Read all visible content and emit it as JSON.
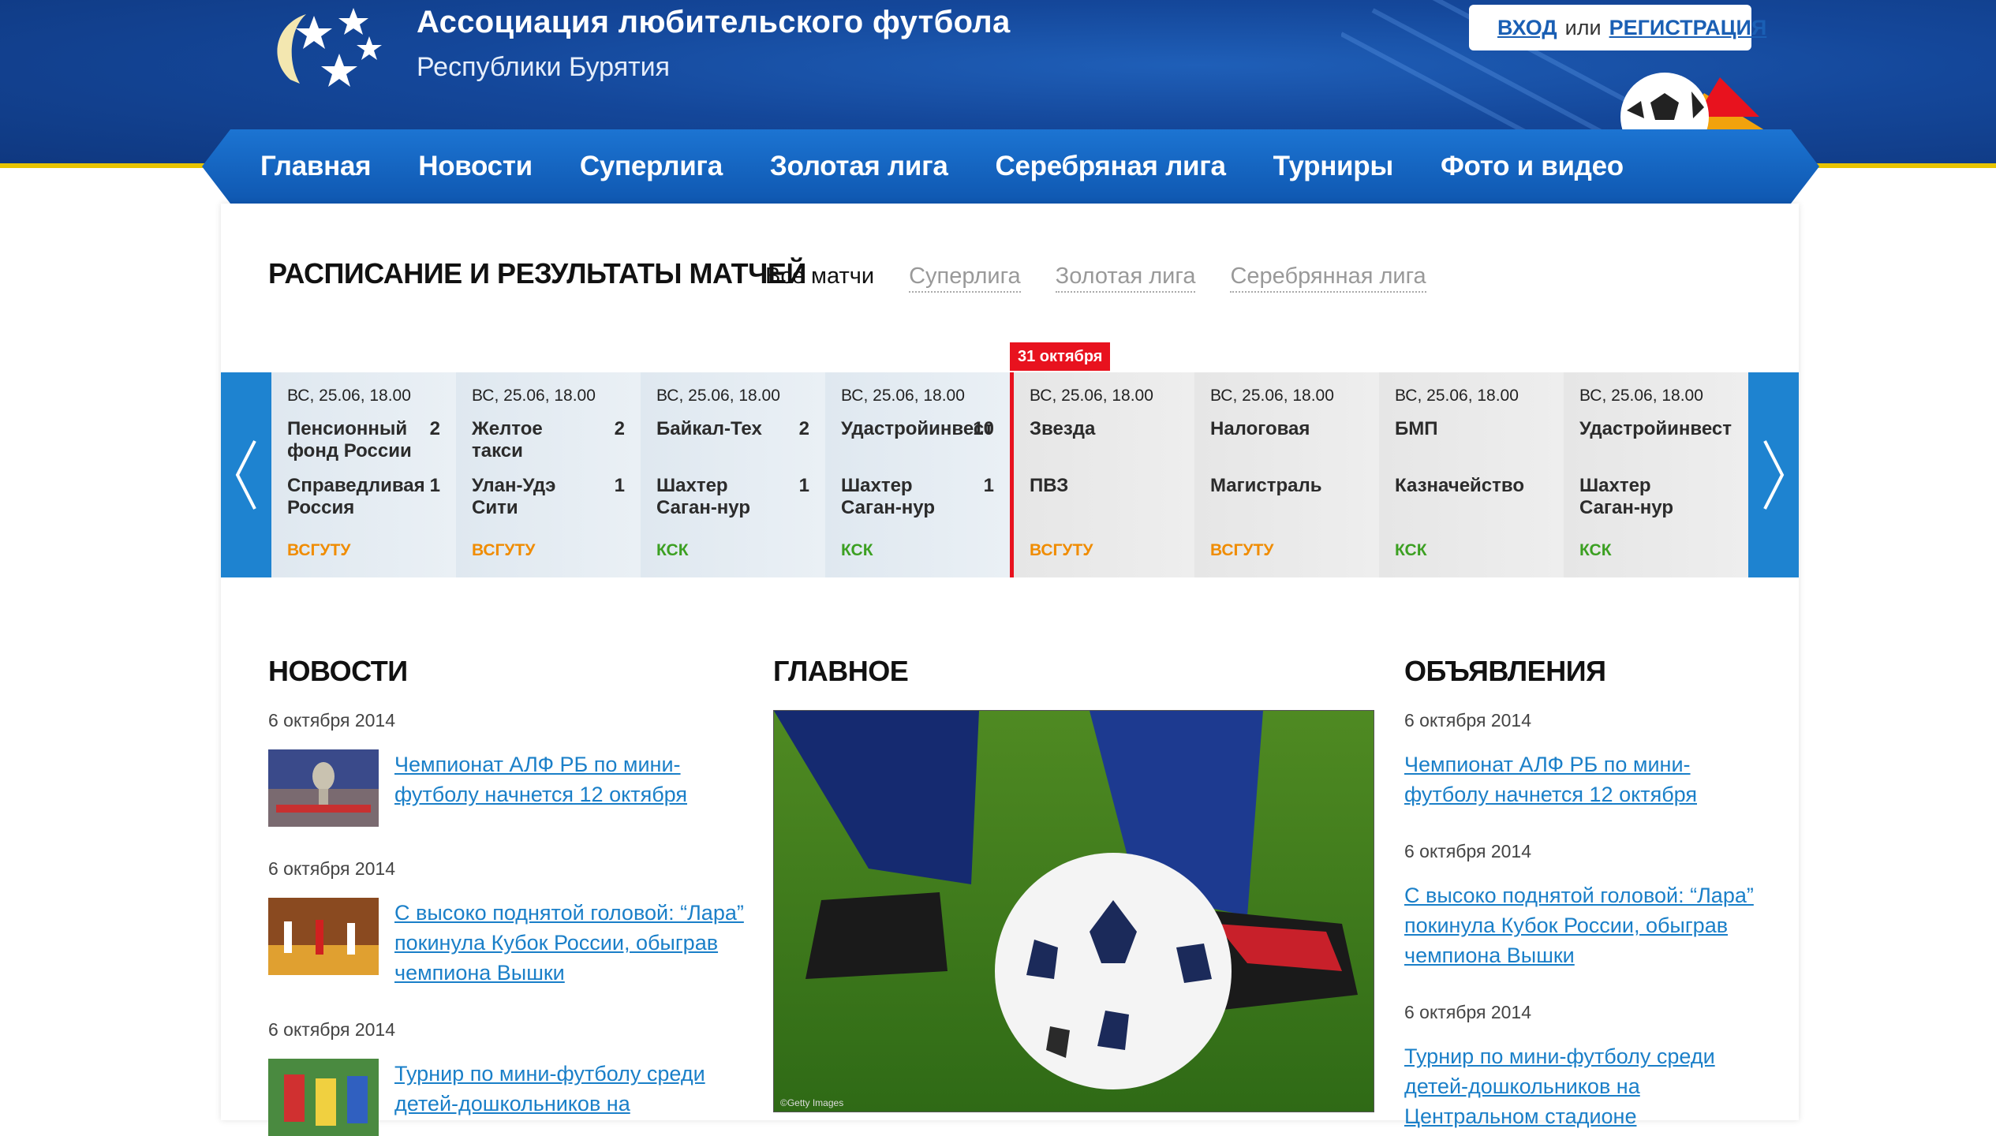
{
  "header": {
    "title": "Ассоциация любительского футбола",
    "subtitle": "Республики Бурятия",
    "login": {
      "enter": "ВХОД",
      "or": "или",
      "register": "РЕГИСТРАЦИЯ"
    }
  },
  "nav": [
    "Главная",
    "Новости",
    "Суперлига",
    "Золотая лига",
    "Серебряная лига",
    "Турниры",
    "Фото и видео"
  ],
  "schedule": {
    "title": "РАСПИСАНИЕ И РЕЗУЛЬТАТЫ МАТЧЕЙ",
    "filters": [
      "Все матчи",
      "Суперлига",
      "Золотая лига",
      "Серебрянная лига"
    ],
    "today_badge": "31 октября",
    "matches": [
      {
        "date": "ВС, 25.06, 18.00",
        "home": "Пенсионный фонд России",
        "home_score": "2",
        "away": "Справедливая Россия",
        "away_score": "1",
        "venue": "ВСГУТУ",
        "venue_color": "#f08c00"
      },
      {
        "date": "ВС, 25.06, 18.00",
        "home": "Желтое такси",
        "home_score": "2",
        "away": "Улан-Удэ Сити",
        "away_score": "1",
        "venue": "ВСГУТУ",
        "venue_color": "#f08c00"
      },
      {
        "date": "ВС, 25.06, 18.00",
        "home": "Байкал-Тех",
        "home_score": "2",
        "away": "Шахтер Саган-нур",
        "away_score": "1",
        "venue": "КСК",
        "venue_color": "#3ca022"
      },
      {
        "date": "ВС, 25.06, 18.00",
        "home": "Удастройинвест",
        "home_score": "10",
        "away": "Шахтер Саган-нур",
        "away_score": "1",
        "venue": "КСК",
        "venue_color": "#3ca022"
      },
      {
        "date": "ВС, 25.06, 18.00",
        "home": "Звезда",
        "home_score": "",
        "away": "ПВЗ",
        "away_score": "",
        "venue": "ВСГУТУ",
        "venue_color": "#f08c00"
      },
      {
        "date": "ВС, 25.06, 18.00",
        "home": "Налоговая",
        "home_score": "",
        "away": "Магистраль",
        "away_score": "",
        "venue": "ВСГУТУ",
        "venue_color": "#f08c00"
      },
      {
        "date": "ВС, 25.06, 18.00",
        "home": "БМП",
        "home_score": "",
        "away": "Казначейство",
        "away_score": "",
        "venue": "КСК",
        "venue_color": "#3ca022"
      },
      {
        "date": "ВС, 25.06, 18.00",
        "home": "Удастройинвест",
        "home_score": "",
        "away": "Шахтер Саган-нур",
        "away_score": "",
        "venue": "КСК",
        "venue_color": "#3ca022"
      }
    ]
  },
  "news": {
    "title": "НОВОСТИ",
    "items": [
      {
        "date": "6 октября 2014",
        "line1": "Чемпионат АЛФ РБ по мини-",
        "line2": "футболу начнется 12 октября",
        "line3": ""
      },
      {
        "date": "6 октября 2014",
        "line1": "С высоко поднятой головой: “Лара”",
        "line2": "покинула Кубок России, обыграв",
        "line3": "чемпиона Вышки"
      },
      {
        "date": "6 октября 2014",
        "line1": "Турнир по мини-футболу среди",
        "line2": "детей-дошкольников на",
        "line3": ""
      }
    ]
  },
  "main": {
    "title": "ГЛАВНОЕ",
    "photo_credit": "©Getty Images"
  },
  "ads": {
    "title": "ОБЪЯВЛЕНИЯ",
    "items": [
      {
        "date": "6 октября 2014",
        "line1": "Чемпионат АЛФ РБ по мини-",
        "line2": "футболу начнется 12 октября",
        "line3": ""
      },
      {
        "date": "6 октября 2014",
        "line1": "С высоко поднятой головой: “Лара”",
        "line2": "покинула Кубок России, обыграв",
        "line3": "чемпиона Вышки"
      },
      {
        "date": "6 октября 2014",
        "line1": "Турнир по мини-футболу среди",
        "line2": "детей-дошкольников на",
        "line3": "Центральном стадионе"
      }
    ]
  }
}
